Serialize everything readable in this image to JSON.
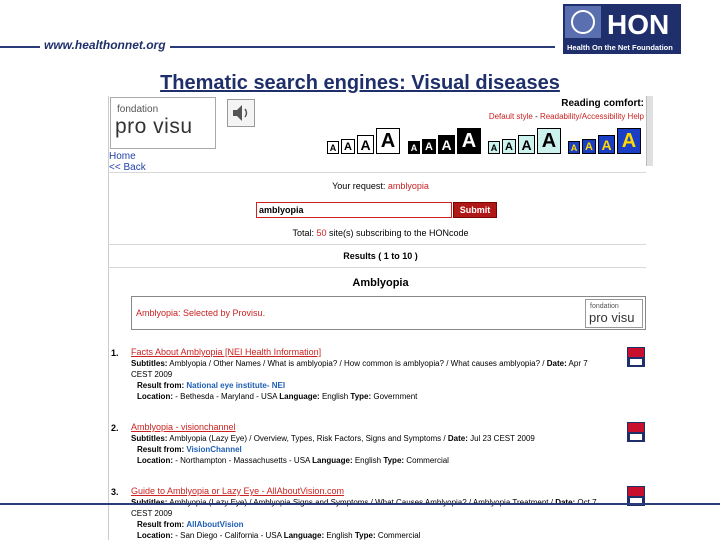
{
  "header": {
    "site_url": "www.healthonnet.org",
    "hon_logo_text": "HON",
    "hon_logo_subtitle": "Health On the Net Foundation",
    "slide_title": "Thematic search engines: Visual diseases"
  },
  "provisu": {
    "logo_top": "fondation",
    "logo_main": "pro visu",
    "nav_home": "Home",
    "nav_back": "<< Back"
  },
  "reading": {
    "title": "Reading comfort:",
    "default_style": "Default style",
    "separator": " - ",
    "help": "Readability/Accessibility Help",
    "letter": "A"
  },
  "search": {
    "request_label": "Your request: ",
    "request_value": "amblyopia",
    "input_value": "amblyopia",
    "submit_label": "Submit",
    "total_prefix": "Total: ",
    "total_count": "50",
    "total_suffix": " site(s) subscribing to the HONcode",
    "results_label": "Results ( 1 to 10 )",
    "topic": "Amblyopia",
    "selected_text": "Amblyopia: Selected by Provisu.",
    "selected_logo_top": "fondation",
    "selected_logo_main": "pro visu"
  },
  "labels": {
    "subtitles": "Subtitles:",
    "date": "Date:",
    "result_from": "Result from:",
    "location": "Location:",
    "language": "Language:",
    "type": "Type:"
  },
  "results": [
    {
      "num": "1.",
      "title": "Facts About Amblyopia [NEI Health Information]",
      "subtitles": " Amblyopia / Other Names / What is amblyopia? / How common is amblyopia? / What causes amblyopia? / ",
      "date": " Apr 7",
      "date_cont": "CEST 2009",
      "from": "National eye institute- NEI",
      "location": " - Bethesda - Maryland - USA ",
      "language": " English ",
      "type": " Government"
    },
    {
      "num": "2.",
      "title": "Amblyopia - visionchannel",
      "subtitles": " Amblyopia (Lazy Eye) / Overview, Types, Risk Factors, Signs and Symptoms / ",
      "date": " Jul 23 CEST 2009",
      "date_cont": "",
      "from": "VisionChannel",
      "location": " - Northampton - Massachusetts - USA ",
      "language": " English ",
      "type": " Commercial"
    },
    {
      "num": "3.",
      "title": "Guide to Amblyopia or Lazy Eye - AllAboutVision.com",
      "subtitles": " Amblyopia (Lazy Eye) / Amblyopia Signs and Symptoms / What Causes Amblyopia? / Amblyopia Treatment / ",
      "date": " Oct 7",
      "date_cont": "CEST 2009",
      "from": "AllAboutVision",
      "location": " - San Diego - California - USA ",
      "language": " English ",
      "type": " Commercial"
    }
  ],
  "colors": {
    "title_navy": "#1f2f6b",
    "accent_red": "#cc2222",
    "link_blue": "#1f5fb4"
  }
}
